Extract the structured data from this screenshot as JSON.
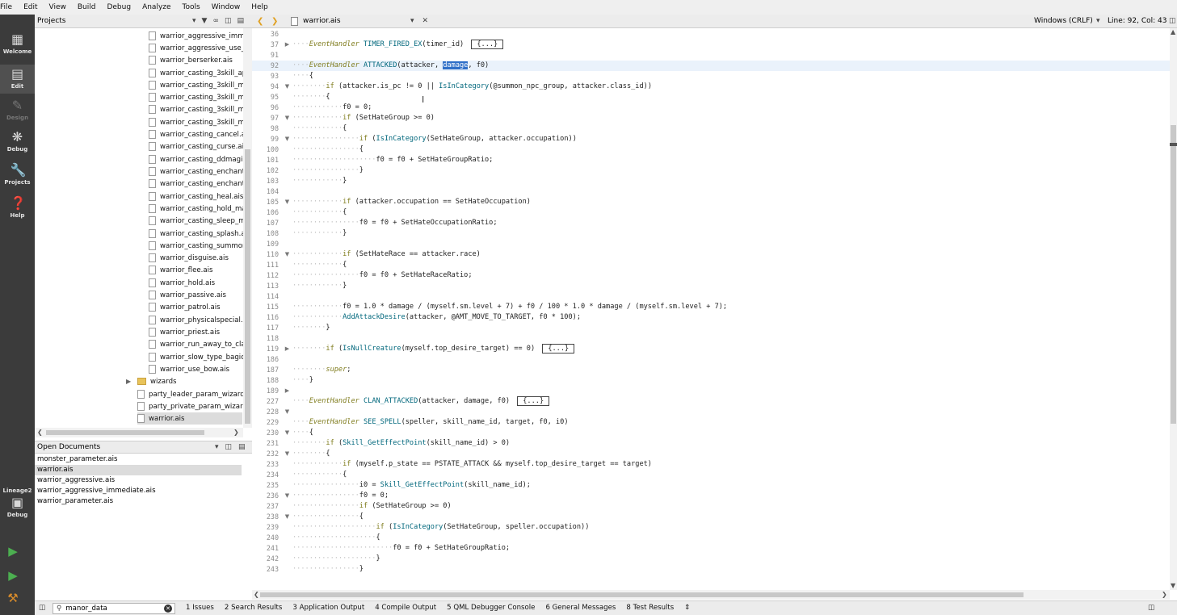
{
  "menubar": [
    "File",
    "Edit",
    "View",
    "Build",
    "Debug",
    "Analyze",
    "Tools",
    "Window",
    "Help"
  ],
  "modes": {
    "welcome": "Welcome",
    "edit": "Edit",
    "design": "Design",
    "debug": "Debug",
    "projects": "Projects",
    "help": "Help",
    "kit": "Lineage2",
    "kit_mode": "Debug"
  },
  "projects_pane": {
    "title": "Projects",
    "tree": [
      "warrior_aggressive_imm",
      "warrior_aggressive_use_l",
      "warrior_berserker.ais",
      "warrior_casting_3skill_ap",
      "warrior_casting_3skill_m",
      "warrior_casting_3skill_m",
      "warrior_casting_3skill_m",
      "warrior_casting_3skill_m",
      "warrior_casting_cancel.a",
      "warrior_casting_curse.ais",
      "warrior_casting_ddmagi",
      "warrior_casting_enchant",
      "warrior_casting_enchant",
      "warrior_casting_heal.ais",
      "warrior_casting_hold_ma",
      "warrior_casting_sleep_m",
      "warrior_casting_splash.a",
      "warrior_casting_summor",
      "warrior_disguise.ais",
      "warrior_flee.ais",
      "warrior_hold.ais",
      "warrior_passive.ais",
      "warrior_patrol.ais",
      "warrior_physicalspecial.a",
      "warrior_priest.ais",
      "warrior_run_away_to_cla",
      "warrior_slow_type_bagic",
      "warrior_use_bow.ais"
    ],
    "folder": "wizards",
    "root_files": [
      "party_leader_param_wizard.",
      "party_private_param_wizard",
      "warrior.ais"
    ]
  },
  "open_documents": {
    "title": "Open Documents",
    "items": [
      "monster_parameter.ais",
      "warrior.ais",
      "warrior_aggressive.ais",
      "warrior_aggressive_immediate.ais",
      "warrior_parameter.ais"
    ]
  },
  "editor": {
    "filename": "warrior.ais",
    "encoding": "Windows (CRLF)",
    "position": "Line: 92, Col: 43",
    "line_numbers": [
      "36",
      "37",
      "91",
      "92",
      "93",
      "94",
      "95",
      "96",
      "97",
      "98",
      "99",
      "100",
      "101",
      "102",
      "103",
      "104",
      "105",
      "106",
      "107",
      "108",
      "109",
      "110",
      "111",
      "112",
      "113",
      "114",
      "115",
      "116",
      "117",
      "118",
      "119",
      "186",
      "187",
      "188",
      "189",
      "227",
      "228",
      "229",
      "230",
      "231",
      "232",
      "233",
      "234",
      "235",
      "236",
      "237",
      "238",
      "239",
      "240",
      "241",
      "242",
      "243"
    ]
  },
  "output_bar": {
    "search_value": "manor_data",
    "tabs": [
      "1  Issues",
      "2  Search Results",
      "3  Application Output",
      "4  Compile Output",
      "5  QML Debugger Console",
      "6  General Messages",
      "8  Test Results"
    ]
  },
  "colors": {
    "keyword": "#807d1f",
    "function": "#00677c",
    "selection": "#3070c8",
    "current_line": "#eaf2fb"
  }
}
